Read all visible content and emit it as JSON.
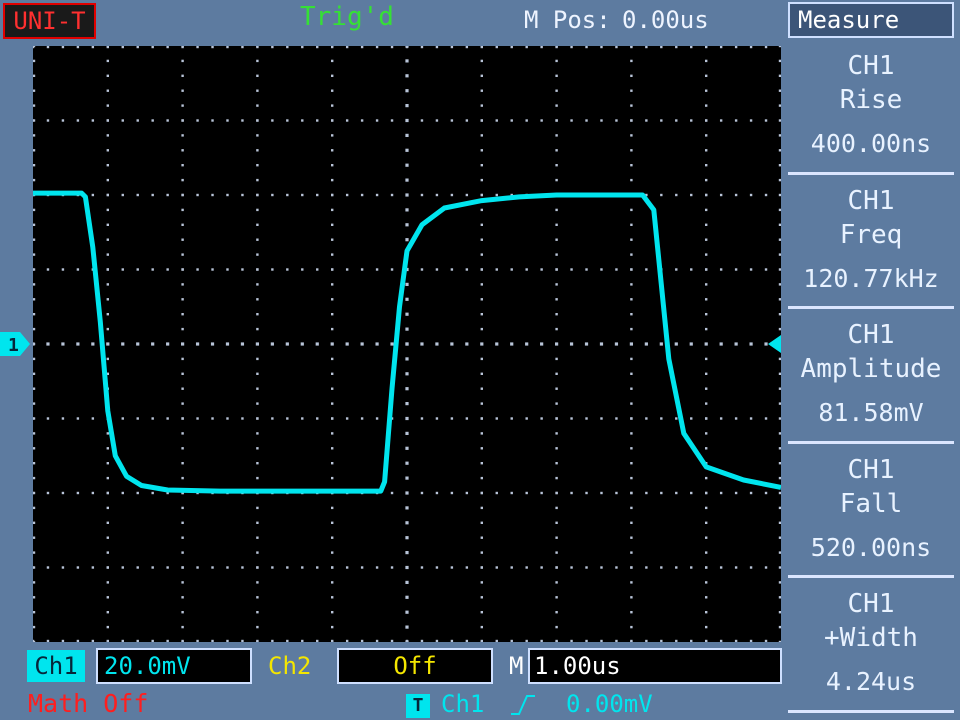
{
  "header": {
    "brand": "UNI-T",
    "trigger_status": "Trig'd",
    "mpos_label": "M Pos:",
    "mpos_value": "0.00us",
    "menu_title": "Measure"
  },
  "measurements": [
    {
      "line1": "CH1",
      "line2": "Rise",
      "value": "400.00ns"
    },
    {
      "line1": "CH1",
      "line2": "Freq",
      "value": "120.77kHz"
    },
    {
      "line1": "CH1",
      "line2": "Amplitude",
      "value": "81.58mV"
    },
    {
      "line1": "CH1",
      "line2": "Fall",
      "value": "520.00ns"
    },
    {
      "line1": "CH1",
      "line2": "+Width",
      "value": "4.24us"
    }
  ],
  "footer": {
    "ch1_label": "Ch1",
    "ch1_scale": "20.0mV",
    "ch2_label": "Ch2",
    "ch2_scale": "Off",
    "timebase_label": "M",
    "timebase_value": "1.00us",
    "math_status": "Math Off",
    "trigger_badge": "T",
    "trigger_source": "Ch1",
    "trigger_level": "0.00mV"
  },
  "channel_marker": "1",
  "colors": {
    "background": "#5d7ba0",
    "screen": "#000000",
    "trace": "#00e5ee",
    "grid": "#b8c4d8",
    "trig_status": "#35e035",
    "ch2": "#f4e600",
    "math": "#ff1e1e",
    "brand": "#ff3030"
  },
  "chart_data": {
    "type": "line",
    "divisions": {
      "x": 10,
      "y": 8
    },
    "x_unit_per_div": "1.00us",
    "y_unit_per_div": "20.0mV",
    "x": [
      0.0,
      0.65,
      0.7,
      0.8,
      0.9,
      1.0,
      1.1,
      1.25,
      1.45,
      1.8,
      2.5,
      3.5,
      4.0,
      4.65,
      4.7,
      4.8,
      4.9,
      5.0,
      5.2,
      5.5,
      6.0,
      6.5,
      7.0,
      7.5,
      8.0,
      8.15,
      8.3,
      8.4,
      8.5,
      8.7,
      9.0,
      9.5,
      10.0
    ],
    "y": [
      40.5,
      40.5,
      39.5,
      26,
      6,
      -18,
      -30,
      -35.5,
      -38,
      -39.2,
      -39.5,
      -39.5,
      -39.5,
      -39.5,
      -37,
      -12,
      10,
      25,
      32,
      36.5,
      38.5,
      39.5,
      40,
      40,
      40,
      40,
      36,
      16,
      -4,
      -24,
      -33,
      -36.5,
      -38.5
    ],
    "y_range": [
      -80,
      80
    ],
    "grid": true
  }
}
